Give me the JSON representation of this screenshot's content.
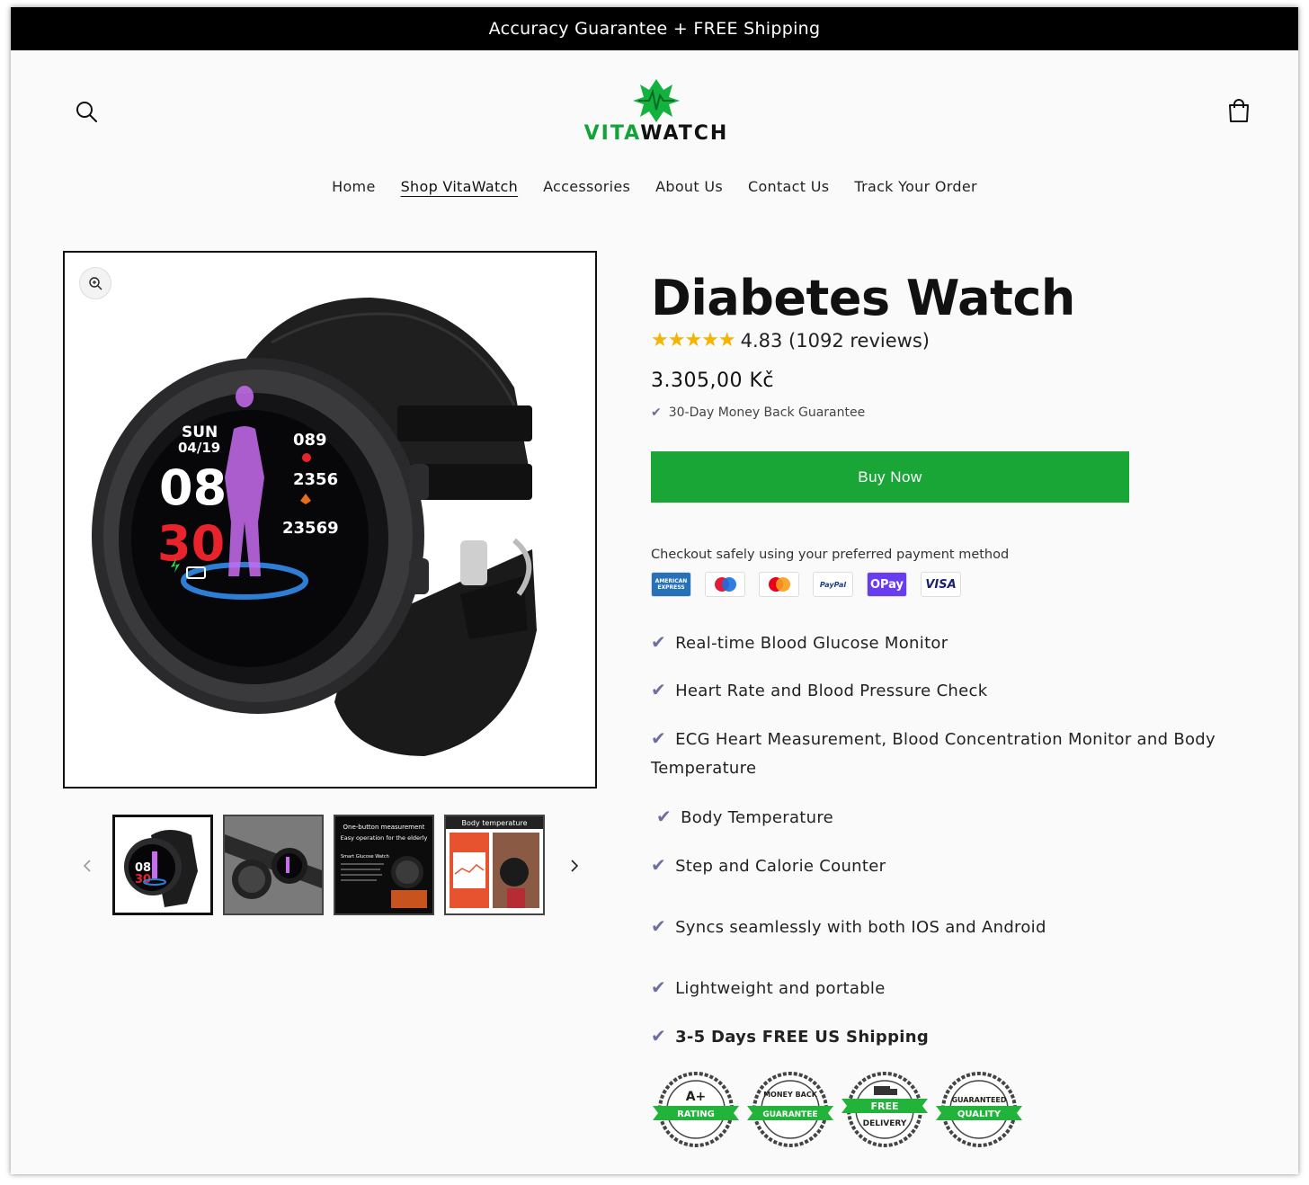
{
  "announcement": "Accuracy Guarantee + FREE Shipping",
  "logo": {
    "part1": "VITA",
    "part2": "WATCH"
  },
  "nav": [
    "Home",
    "Shop VitaWatch",
    "Accessories",
    "About Us",
    "Contact Us",
    "Track Your Order"
  ],
  "product": {
    "title": "Diabetes Watch",
    "rating_text": "4.83 (1092 reviews)",
    "price": "3.305,00 Kč",
    "guarantee": "30-Day Money Back Guarantee",
    "buy_label": "Buy Now",
    "checkout_text": "Checkout safely using your preferred payment method"
  },
  "watch_face": {
    "day": "SUN",
    "date": "04/19",
    "hour": "08",
    "minute": "30",
    "v1": "089",
    "v2": "2356",
    "v3": "23569"
  },
  "payments": [
    {
      "name": "american-express-icon",
      "label": "AMERICAN EXPRESS"
    },
    {
      "name": "maestro-icon",
      "label": ""
    },
    {
      "name": "mastercard-icon",
      "label": ""
    },
    {
      "name": "paypal-icon",
      "label": "PayPal"
    },
    {
      "name": "opay-icon",
      "label": "OPay"
    },
    {
      "name": "visa-icon",
      "label": "VISA"
    }
  ],
  "features": [
    "Real-time Blood Glucose Monitor",
    "Heart Rate and Blood Pressure Check",
    "ECG Heart Measurement, Blood Concentration Monitor and Body",
    "Temperature",
    "Body Temperature",
    "Step and Calorie Counter",
    "Syncs seamlessly with both IOS and Android",
    "Lightweight and portable",
    "3-5 Days FREE US Shipping"
  ],
  "thumbs": {
    "t3_line1": "One-button measurement",
    "t3_line2": "Easy operation for the elderly",
    "t3_line3": "Smart Glucose Watch",
    "t4_title": "Body temperature"
  },
  "badges": [
    {
      "top": "A+",
      "ribbon": "RATING"
    },
    {
      "top": "MONEY BACK",
      "ribbon": "GUARANTEE"
    },
    {
      "top": "FREE",
      "ribbon": "DELIVERY"
    },
    {
      "top": "GUARANTEED",
      "ribbon": "QUALITY"
    }
  ],
  "colors": {
    "accent": "#1aa637",
    "check": "#6e6ea3",
    "star": "#f5b400"
  }
}
